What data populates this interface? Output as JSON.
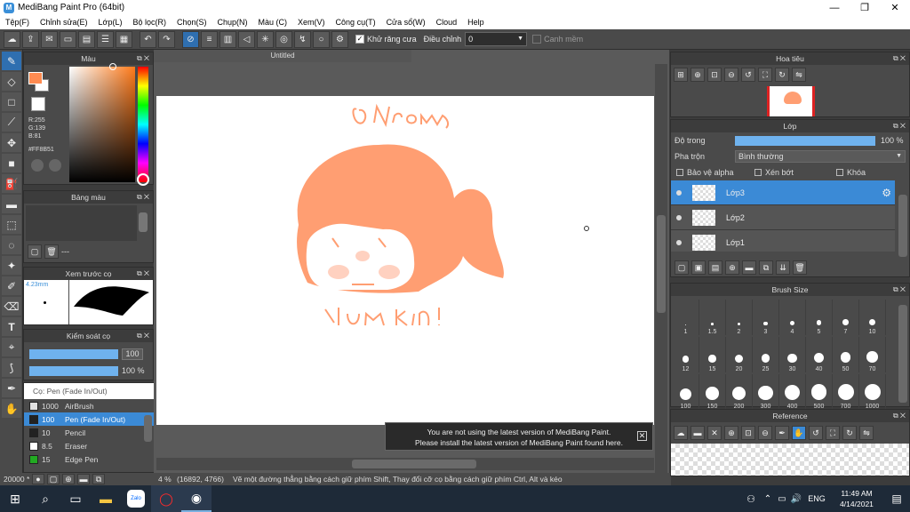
{
  "window": {
    "title": "MediBang Paint Pro (64bit)",
    "min": "—",
    "max": "❐",
    "close": "✕"
  },
  "menu": [
    "Tệp(F)",
    "Chỉnh sửa(E)",
    "Lớp(L)",
    "Bộ lọc(R)",
    "Chọn(S)",
    "Chụp(N)",
    "Màu (C)",
    "Xem(V)",
    "Công cụ(T)",
    "Cửa sổ(W)",
    "Cloud",
    "Help"
  ],
  "toolbar": {
    "anti_alias_label": "Khử răng cưa",
    "correction_label": "Điều chỉnh",
    "correction_value": "0",
    "snap_label": "Canh mềm"
  },
  "canvas": {
    "tab_title": "Untitled",
    "zoom_text": "4 %",
    "coords": "(16892, 4766)",
    "hint": "Vẽ một đường thẳng bằng cách giữ phím Shift, Thay đổi cỡ cọ bằng cách giữ phím Ctrl, Alt và kéo",
    "size_left": "20000 *"
  },
  "color_panel": {
    "title": "Màu",
    "r": "R:255",
    "g": "G:139",
    "b": "B:81",
    "hex": "#FF8B51",
    "fg_color": "#FF8B51",
    "bg_color": "#FFFFFF"
  },
  "palette_panel": {
    "title": "Bảng màu",
    "extra": "---"
  },
  "preview_panel": {
    "title": "Xem trước cọ",
    "size": "4.23mm"
  },
  "brush_control": {
    "title": "Kiểm soát cọ",
    "size_value": "100",
    "opacity_value": "100 %"
  },
  "brush_list": {
    "title": "Cọ: Pen (Fade In/Out)",
    "items": [
      {
        "size": "1000",
        "name": "AirBrush",
        "color": "#e0e0e0"
      },
      {
        "size": "100",
        "name": "Pen (Fade In/Out)",
        "color": "#222222"
      },
      {
        "size": "10",
        "name": "Pencil",
        "color": "#222222"
      },
      {
        "size": "8.5",
        "name": "Eraser",
        "color": "#ffffff"
      },
      {
        "size": "15",
        "name": "Edge Pen",
        "color": "#22aa22"
      }
    ]
  },
  "navigator": {
    "title": "Hoa tiêu"
  },
  "layers": {
    "title": "Lớp",
    "opacity_label": "Độ trong",
    "opacity_value": "100 %",
    "blend_label": "Pha trộn",
    "blend_value": "Bình thường",
    "protect_alpha": "Bảo vệ alpha",
    "clipping": "Xén bớt",
    "lock": "Khóa",
    "items": [
      {
        "name": "Lớp3",
        "selected": true
      },
      {
        "name": "Lớp2",
        "selected": false
      },
      {
        "name": "Lớp1",
        "selected": false
      }
    ]
  },
  "brush_size": {
    "title": "Brush Size",
    "sizes": [
      "1",
      "1.5",
      "2",
      "3",
      "4",
      "5",
      "7",
      "10",
      "12",
      "15",
      "20",
      "25",
      "30",
      "40",
      "50",
      "70",
      "100",
      "150",
      "200",
      "300",
      "400",
      "500",
      "700",
      "1000"
    ]
  },
  "reference": {
    "title": "Reference"
  },
  "notice": {
    "line1": "You are not using the latest version of MediBang Paint.",
    "line2": "Please install the latest version of MediBang Paint found here."
  },
  "artwork": {
    "top_text": "@Nrom",
    "bottom_text": "Trùm kín !",
    "hair_color": "#FF9E72"
  },
  "taskbar": {
    "time": "11:49 AM",
    "date": "4/14/2021",
    "lang": "ENG"
  }
}
